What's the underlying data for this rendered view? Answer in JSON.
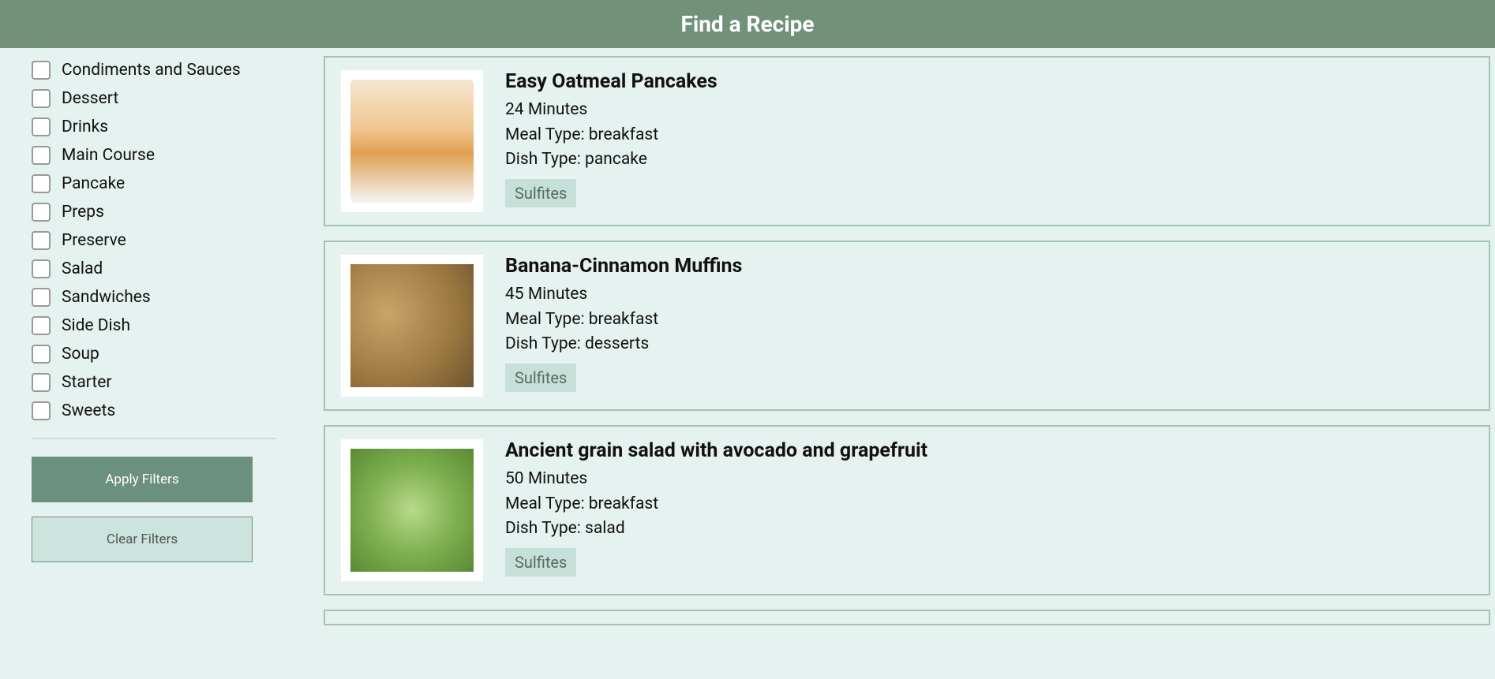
{
  "header": {
    "title": "Find a Recipe"
  },
  "filters": {
    "items": [
      {
        "label": "Condiments and Sauces"
      },
      {
        "label": "Dessert"
      },
      {
        "label": "Drinks"
      },
      {
        "label": "Main Course"
      },
      {
        "label": "Pancake"
      },
      {
        "label": "Preps"
      },
      {
        "label": "Preserve"
      },
      {
        "label": "Salad"
      },
      {
        "label": "Sandwiches"
      },
      {
        "label": "Side Dish"
      },
      {
        "label": "Soup"
      },
      {
        "label": "Starter"
      },
      {
        "label": "Sweets"
      }
    ],
    "apply_label": "Apply Filters",
    "clear_label": "Clear Filters"
  },
  "recipes": [
    {
      "title": "Easy Oatmeal Pancakes",
      "time": "24 Minutes",
      "meal_type": "Meal Type: breakfast",
      "dish_type": "Dish Type: pancake",
      "tag": "Sulfites",
      "img_class": "img-pancakes"
    },
    {
      "title": "Banana-Cinnamon Muffins",
      "time": "45 Minutes",
      "meal_type": "Meal Type: breakfast",
      "dish_type": "Dish Type: desserts",
      "tag": "Sulfites",
      "img_class": "img-muffins"
    },
    {
      "title": "Ancient grain salad with avocado and grapefruit",
      "time": "50 Minutes",
      "meal_type": "Meal Type: breakfast",
      "dish_type": "Dish Type: salad",
      "tag": "Sulfites",
      "img_class": "img-salad"
    }
  ]
}
